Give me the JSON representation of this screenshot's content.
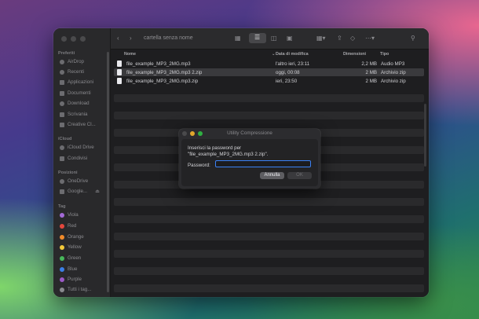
{
  "finder": {
    "title": "cartella senza nome",
    "nav": {
      "back_icon": "chevron-left-icon",
      "forward_icon": "chevron-right-icon"
    },
    "sidebar": {
      "favorites_label": "Preferiti",
      "favorites": [
        "AirDrop",
        "Recenti",
        "Applicazioni",
        "Documenti",
        "Download",
        "Scrivania",
        "Creative Cl..."
      ],
      "icloud_label": "iCloud",
      "icloud": [
        "iCloud Drive",
        "Condivisi"
      ],
      "locations_label": "Posizioni",
      "locations": [
        "OneDrive",
        "Google..."
      ],
      "tags_label": "Tag",
      "tags": [
        {
          "name": "Viola",
          "color": "#a36ad6"
        },
        {
          "name": "Red",
          "color": "#e4473d"
        },
        {
          "name": "Orange",
          "color": "#f08a2a"
        },
        {
          "name": "Yellow",
          "color": "#f2c83a"
        },
        {
          "name": "Green",
          "color": "#47b85a"
        },
        {
          "name": "Blue",
          "color": "#3b7fe6"
        },
        {
          "name": "Purple",
          "color": "#9b59c6"
        },
        {
          "name": "Tutti i tag...",
          "color": "#8a8a8e"
        }
      ]
    },
    "columns": {
      "name": "Nome",
      "date": "Data di modifica",
      "size": "Dimensioni",
      "kind": "Tipo"
    },
    "files": [
      {
        "name": "file_example_MP3_2MG.mp3",
        "date": "l'altro ieri, 23:11",
        "size": "2,2 MB",
        "kind": "Audio MP3"
      },
      {
        "name": "file_example_MP3_2MG.mp3 2.zip",
        "date": "oggi, 00:08",
        "size": "2 MB",
        "kind": "Archivio zip"
      },
      {
        "name": "file_example_MP3_2MG.mp3.zip",
        "date": "ieri, 23:50",
        "size": "2 MB",
        "kind": "Archivio zip"
      }
    ]
  },
  "dialog": {
    "title": "Utility Compressione",
    "message_line1": "Inserisci la password per",
    "message_line2": "\"file_example_MP3_2MG.mp3 2.zip\".",
    "password_label": "Password:",
    "password_value": "",
    "cancel_label": "Annulla",
    "ok_label": "OK",
    "accent_color": "#3b82f6"
  }
}
